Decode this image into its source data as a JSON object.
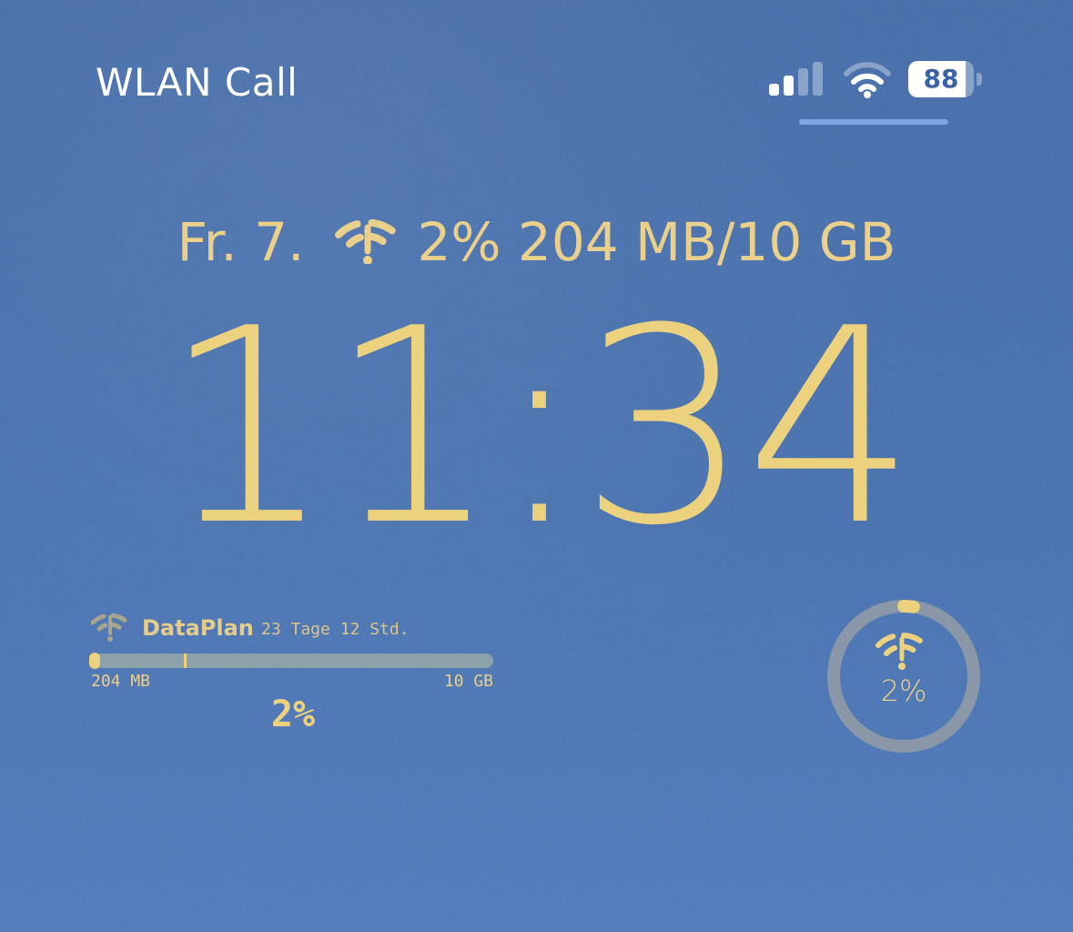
{
  "status_bar": {
    "carrier": "WLAN Call",
    "battery": {
      "level": "88",
      "fraction": 0.88
    },
    "signal_bars": {
      "total": 4,
      "active": 2
    },
    "icons": [
      "signal-bars-icon",
      "wifi-icon",
      "battery-icon"
    ]
  },
  "lock_screen": {
    "date": "Fr. 7.",
    "info_widget": {
      "icon": "wifi-antenna-icon",
      "text": "2% 204 MB/10 GB"
    },
    "time": "11:34"
  },
  "dataplan_widget": {
    "icon": "wifi-antenna-icon",
    "title": "DataPlan",
    "remaining": "23 Tage 12 Std.",
    "used_label": "204 MB",
    "total_label": "10 GB",
    "percent": "2%",
    "progress_fraction": 0.02,
    "day_marker_fraction": 0.23
  },
  "ring_widget": {
    "icon": "wifi-antenna-icon",
    "percent": "2%",
    "progress_fraction": 0.02
  },
  "colors": {
    "background": "#3d6bb0",
    "accent": "#ecd17e",
    "track": "#8a97a8",
    "status_text": "#ffffff"
  }
}
